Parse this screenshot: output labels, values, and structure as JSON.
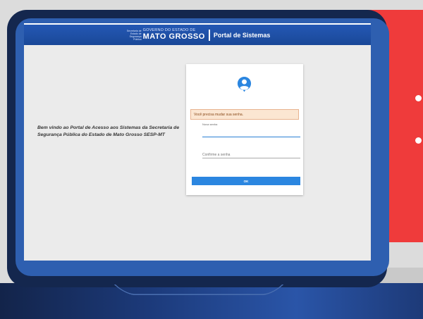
{
  "header": {
    "gov_small_text": "Secretaria de Estado de Segurança Pública",
    "gov_line": "GOVERNO DO ESTADO DE",
    "state_name": "MATO GROSSO",
    "portal_title": "Portal de Sistemas"
  },
  "welcome": {
    "text": "Bem vindo ao Portal de Acesso aos Sistemas da Secretaria de Segurança Pública do Estado de Mato Grosso SESP-MT"
  },
  "form": {
    "alert_text": "Você precisa mudar sua senha.",
    "new_password_label": "Nova senha",
    "new_password_value": "",
    "confirm_password_placeholder": "Confirme a senha",
    "submit_label": "OK"
  },
  "icons": {
    "avatar": "user-circle-icon"
  },
  "colors": {
    "header_blue": "#1f50a6",
    "button_blue": "#2b86e0",
    "alert_bg": "#fbe6d2",
    "accent_red": "#ef3b3b"
  }
}
